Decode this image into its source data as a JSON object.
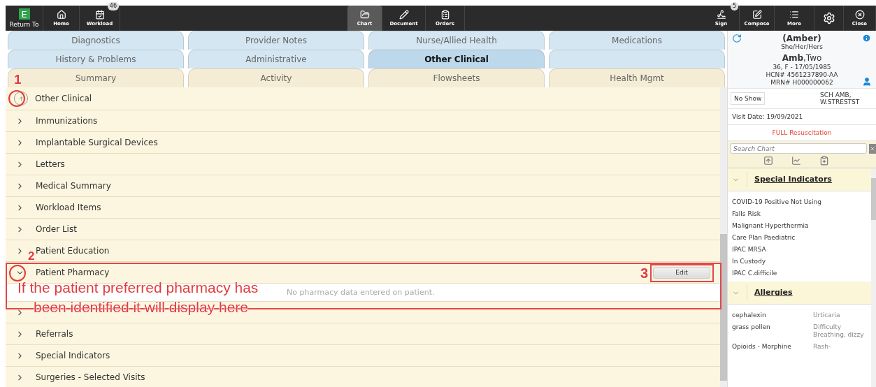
{
  "toolbar": {
    "left": [
      {
        "kind": "logo",
        "label": "Return To",
        "glyph": "E"
      },
      {
        "kind": "home",
        "label": "Home"
      },
      {
        "kind": "workload",
        "label": "Workload",
        "badge": "46"
      }
    ],
    "center": [
      {
        "kind": "chart",
        "label": "Chart",
        "selected": true
      },
      {
        "kind": "document",
        "label": "Document",
        "selected": false
      },
      {
        "kind": "orders",
        "label": "Orders",
        "selected": false
      }
    ],
    "right": [
      {
        "kind": "sign",
        "label": "Sign",
        "badge": "5"
      },
      {
        "kind": "compose",
        "label": "Compose"
      },
      {
        "kind": "more",
        "label": "More"
      },
      {
        "kind": "gear"
      },
      {
        "kind": "close",
        "label": "Close"
      }
    ]
  },
  "tab_rows": [
    {
      "color": "#d4e6f1",
      "tabs": [
        {
          "label": "Diagnostics",
          "selected": false
        },
        {
          "label": "Provider Notes",
          "selected": false
        },
        {
          "label": "Nurse/Allied Health",
          "selected": false
        },
        {
          "label": "Medications",
          "selected": false
        }
      ]
    },
    {
      "color": "#d4e6f1",
      "tabs": [
        {
          "label": "History & Problems",
          "selected": false
        },
        {
          "label": "Administrative",
          "selected": false
        },
        {
          "label": "Other Clinical",
          "selected": true
        }
      ]
    },
    {
      "color": "#f4ecd4",
      "tabs": [
        {
          "label": "Summary",
          "selected": false
        },
        {
          "label": "Activity",
          "selected": false
        },
        {
          "label": "Flowsheets",
          "selected": false
        },
        {
          "label": "Health Mgmt",
          "selected": false
        }
      ]
    }
  ],
  "section": {
    "title": "Other Clinical",
    "items": [
      {
        "label": "Immunizations",
        "expanded": false
      },
      {
        "label": "Implantable Surgical Devices",
        "expanded": false
      },
      {
        "label": "Letters",
        "expanded": false
      },
      {
        "label": "Medical Summary",
        "expanded": false
      },
      {
        "label": "Workload Items",
        "expanded": false
      },
      {
        "label": "Order List",
        "expanded": false
      },
      {
        "label": "Patient Education",
        "expanded": false
      },
      {
        "label": "Patient Pharmacy",
        "expanded": true,
        "button": "Edit",
        "body": "No pharmacy data entered on patient."
      },
      {
        "expanded": false
      },
      {
        "label": "Referrals",
        "expanded": false
      },
      {
        "label": "Special Indicators",
        "expanded": false
      },
      {
        "label": "Surgeries - Selected Visits",
        "expanded": false
      }
    ]
  },
  "annotations": {
    "step_1": "1",
    "step_2": "2",
    "step_3": "3",
    "note": "If the patient preferred pharmacy has been identified it will display here"
  },
  "patient": {
    "preferred_name": "(Amber)",
    "pronouns": "She/Her/Hers",
    "last_name": "Amb",
    "first_name": ",Two",
    "age_sex_dob": "36, F - 17/05/1985",
    "hcn": "HCN# 4561237890-AA",
    "mrn": "MRN# H000000062",
    "status_button": "No Show",
    "location": "SCH AMB, W.STRESTST",
    "visit_date": "Visit Date: 19/09/2021",
    "code_status": "FULL Resuscitation",
    "search": {
      "placeholder": "Search Chart"
    }
  },
  "side_sections": [
    {
      "title": "Special Indicators",
      "expanded": true,
      "items": [
        {
          "name": "COVID-19 Positive Not Using"
        },
        {
          "name": "Falls Risk"
        },
        {
          "name": "Malignant Hyperthermia"
        },
        {
          "name": "Care Plan Paediatric"
        },
        {
          "name": "IPAC MRSA"
        },
        {
          "name": "In Custody"
        },
        {
          "name": "IPAC C.difficile"
        }
      ]
    },
    {
      "title": "Allergies",
      "expanded": true,
      "items": [
        {
          "name": "cephalexin",
          "reaction": "Urticaria"
        },
        {
          "name": "grass pollen",
          "reaction": "Difficulty Breathing, dizzy"
        },
        {
          "name": "Opioids - Morphine",
          "reaction": "Rash-"
        }
      ]
    }
  ]
}
